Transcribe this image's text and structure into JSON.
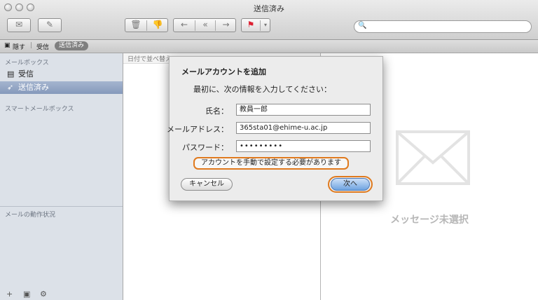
{
  "window": {
    "title": "送信済み"
  },
  "toolbar": {
    "get_mail_icon": "inbox-icon",
    "compose_icon": "compose-icon",
    "delete_icon": "trash-icon",
    "junk_icon": "thumbs-down-icon",
    "reply_icon": "reply-icon",
    "reply_all_icon": "reply-all-icon",
    "forward_icon": "forward-icon",
    "flag_icon": "flag-icon",
    "search_placeholder": ""
  },
  "favbar": {
    "hide": "隠す",
    "inbox": "受信",
    "sent": "送信済み"
  },
  "sidebar": {
    "mailboxes_header": "メールボックス",
    "items": [
      {
        "label": "受信",
        "icon": "inbox-tray-icon",
        "selected": false
      },
      {
        "label": "送信済み",
        "icon": "paper-plane-icon",
        "selected": true
      }
    ],
    "smart_header": "スマートメールボックス",
    "activity_header": "メールの動作状況",
    "bottom": {
      "add": "+",
      "show": "▣",
      "gear": "⚙"
    }
  },
  "message_list": {
    "sort_label": "日付で並べ替え"
  },
  "viewer": {
    "empty_text": "メッセージ未選択",
    "empty_icon": "envelope-icon"
  },
  "dialog": {
    "title": "メールアカウントを追加",
    "intro": "最初に、次の情報を入力してください：",
    "name_label": "氏名：",
    "name_value": "教員一郎",
    "email_label": "メールアドレス：",
    "email_value": "365sta01@ehime-u.ac.jp",
    "password_label": "パスワード：",
    "password_value": "•••••••••",
    "warning": "アカウントを手動で設定する必要があります",
    "cancel": "キャンセル",
    "next": "次へ"
  },
  "colors": {
    "highlight_orange": "#e07a1e",
    "sidebar_bg": "#dce1e8",
    "default_button": "#6ea3e0"
  }
}
